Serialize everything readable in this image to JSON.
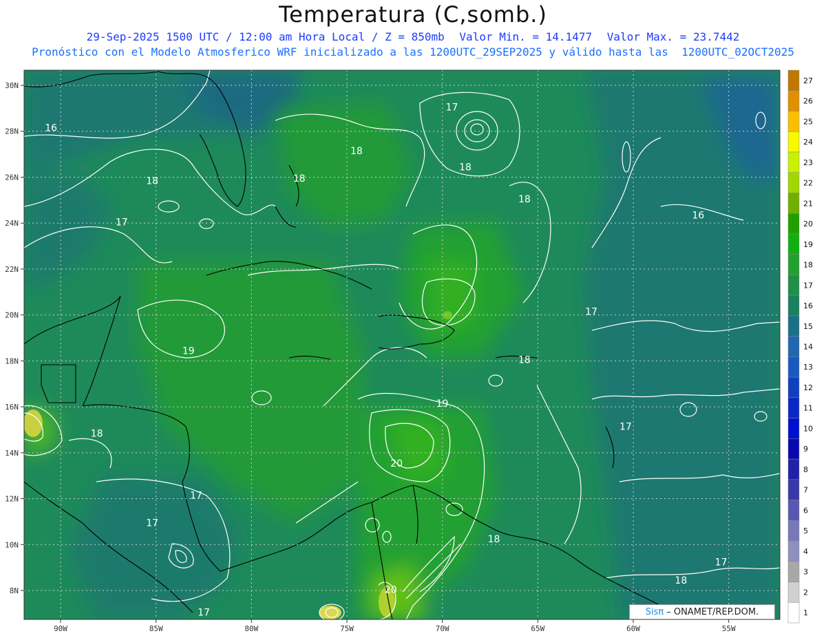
{
  "title": "Temperatura (C,somb.)",
  "subtitle1": {
    "datetime": "29-Sep-2025 1500 UTC / 12:00 am Hora Local / Z = 850mb",
    "min": "Valor Min. = 14.1477",
    "max": "Valor Max. = 23.7442"
  },
  "subtitle2": "Pronóstico con el Modelo Atmosferico WRF inicializado a las 1200UTC_29SEP2025 y válido hasta las  1200UTC_02OCT2025",
  "lat_labels": [
    "30N",
    "28N",
    "26N",
    "24N",
    "22N",
    "20N",
    "18N",
    "16N",
    "14N",
    "12N",
    "10N",
    "8N"
  ],
  "lon_labels": [
    "90W",
    "85W",
    "80W",
    "75W",
    "70W",
    "65W",
    "60W",
    "55W"
  ],
  "colorbar": {
    "labels": [
      "27",
      "26",
      "25",
      "24",
      "23",
      "22",
      "21",
      "20",
      "19",
      "18",
      "17",
      "16",
      "15",
      "14",
      "13",
      "12",
      "11",
      "10",
      "9",
      "8",
      "7",
      "6",
      "5",
      "4",
      "3",
      "2",
      "1"
    ],
    "colors": [
      "#c07800",
      "#e09000",
      "#f8c000",
      "#f8f800",
      "#c8f000",
      "#a0d800",
      "#70b000",
      "#20a000",
      "#10b010",
      "#22a030",
      "#1e9048",
      "#1a8060",
      "#1a7088",
      "#2068b0",
      "#1858c0",
      "#1040c0",
      "#0828c8",
      "#0010d0",
      "#0808b0",
      "#2020a8",
      "#3838a8",
      "#5858b0",
      "#7878b8",
      "#9090c0",
      "#a8a8a8",
      "#d0d0d0",
      "#ffffff"
    ]
  },
  "contour_labels": [
    {
      "text": "16",
      "lon": -90.5,
      "lat": 28.0
    },
    {
      "text": "18",
      "lon": -85.2,
      "lat": 25.7
    },
    {
      "text": "17",
      "lon": -86.8,
      "lat": 23.9
    },
    {
      "text": "18",
      "lon": -77.5,
      "lat": 25.8
    },
    {
      "text": "18",
      "lon": -74.5,
      "lat": 27.0
    },
    {
      "text": "17",
      "lon": -69.5,
      "lat": 28.9
    },
    {
      "text": "18",
      "lon": -68.8,
      "lat": 26.3
    },
    {
      "text": "18",
      "lon": -65.7,
      "lat": 24.9
    },
    {
      "text": "16",
      "lon": -56.6,
      "lat": 24.2
    },
    {
      "text": "17",
      "lon": -62.2,
      "lat": 20.0
    },
    {
      "text": "19",
      "lon": -83.3,
      "lat": 18.3
    },
    {
      "text": "18",
      "lon": -65.7,
      "lat": 17.9
    },
    {
      "text": "19",
      "lon": -70.0,
      "lat": 16.0
    },
    {
      "text": "18",
      "lon": -88.1,
      "lat": 14.7
    },
    {
      "text": "17",
      "lon": -60.4,
      "lat": 15.0
    },
    {
      "text": "20",
      "lon": -72.4,
      "lat": 13.4
    },
    {
      "text": "17",
      "lon": -82.9,
      "lat": 12.0
    },
    {
      "text": "17",
      "lon": -85.2,
      "lat": 10.8
    },
    {
      "text": "18",
      "lon": -67.3,
      "lat": 10.1
    },
    {
      "text": "17",
      "lon": -55.4,
      "lat": 9.1
    },
    {
      "text": "18",
      "lon": -57.5,
      "lat": 8.3
    },
    {
      "text": "20",
      "lon": -72.7,
      "lat": 7.9
    },
    {
      "text": "17",
      "lon": -82.5,
      "lat": 6.9
    }
  ],
  "credit": {
    "logo": "Sisπ",
    "org": "– ONAMET/REP.DOM."
  }
}
